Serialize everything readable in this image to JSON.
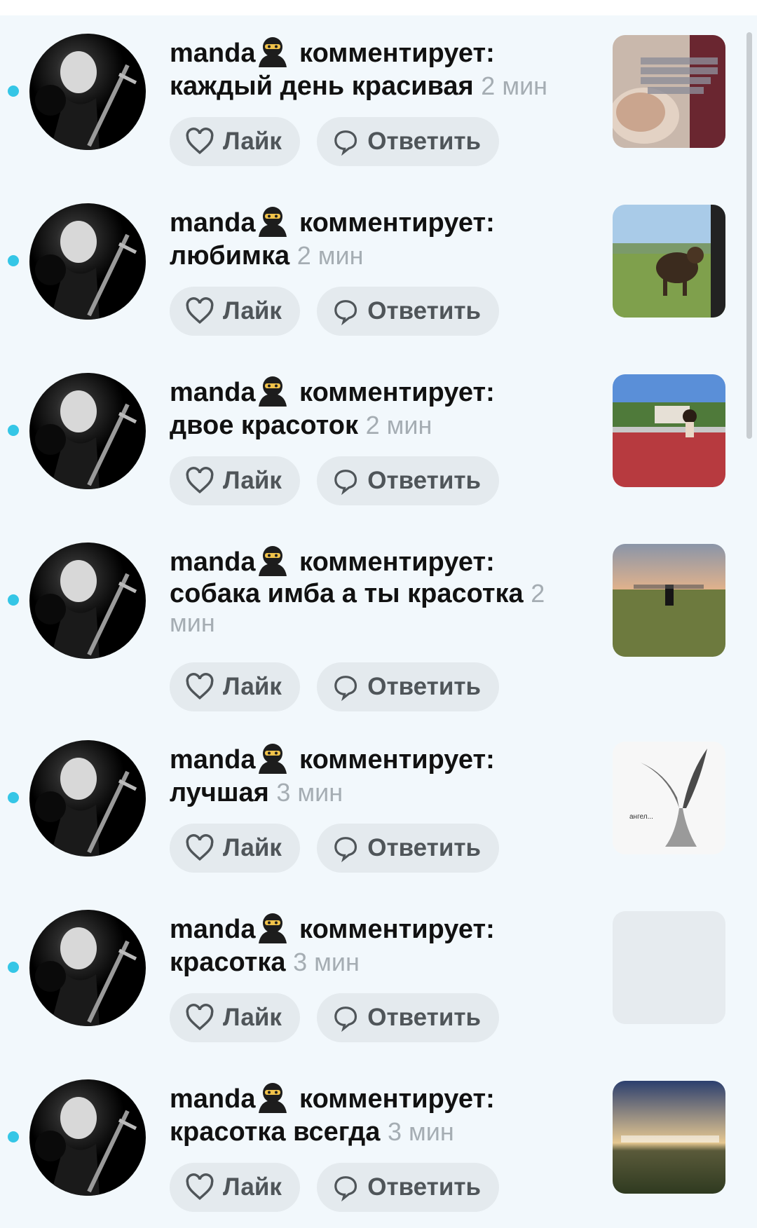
{
  "notifications": [
    {
      "user": "manda",
      "action": "комментирует:",
      "comment": "каждый день красивая",
      "time": "2 мин",
      "like_label": "Лайк",
      "reply_label": "Ответить",
      "thumb": "photo-woman-with-text",
      "unread": true
    },
    {
      "user": "manda",
      "action": "комментирует:",
      "comment": "любимка",
      "time": "2 мин",
      "like_label": "Лайк",
      "reply_label": "Ответить",
      "thumb": "photo-dog-on-grass",
      "unread": true
    },
    {
      "user": "manda",
      "action": "комментирует:",
      "comment": "двое красоток",
      "time": "2 мин",
      "like_label": "Лайк",
      "reply_label": "Ответить",
      "thumb": "photo-red-track",
      "unread": true
    },
    {
      "user": "manda",
      "action": "комментирует:",
      "comment": "собака имба а ты красотка",
      "time": "2 мин",
      "like_label": "Лайк",
      "reply_label": "Ответить",
      "thumb": "photo-field-sunset",
      "unread": true
    },
    {
      "user": "manda",
      "action": "комментирует:",
      "comment": "лучшая",
      "time": "3 мин",
      "like_label": "Лайк",
      "reply_label": "Ответить",
      "thumb": "drawing-angel",
      "thumb_caption": "ангел...",
      "unread": true
    },
    {
      "user": "manda",
      "action": "комментирует:",
      "comment": "красотка",
      "time": "3 мин",
      "like_label": "Лайк",
      "reply_label": "Ответить",
      "thumb": "blank",
      "unread": true
    },
    {
      "user": "manda",
      "action": "комментирует:",
      "comment": "красотка всегда",
      "time": "3 мин",
      "like_label": "Лайк",
      "reply_label": "Ответить",
      "thumb": "photo-sky-horizon",
      "unread": true
    }
  ],
  "colors": {
    "background": "#f2f8fc",
    "unread_dot": "#35c6e6",
    "button_bg": "#e4eaee",
    "time_text": "#a5adb3"
  },
  "icons": {
    "like": "heart-outline-icon",
    "reply": "speech-bubble-icon",
    "user_emoji": "ninja-emoji-icon"
  }
}
